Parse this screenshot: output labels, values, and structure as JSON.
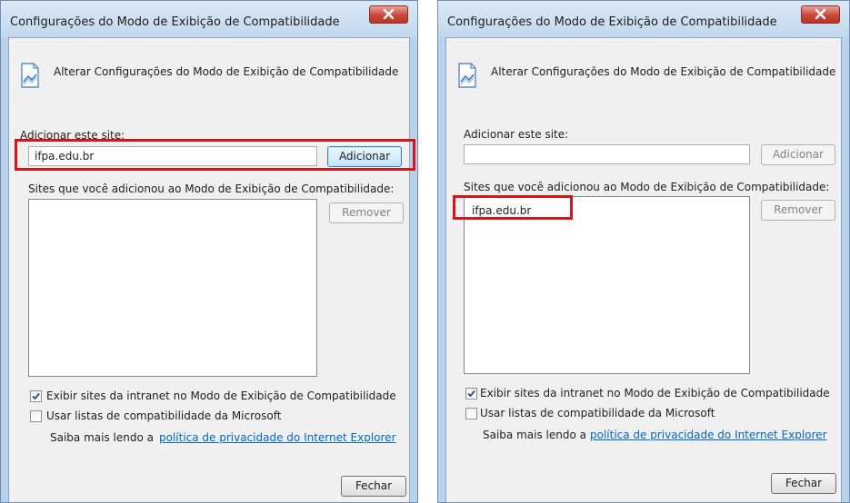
{
  "left": {
    "title": "Configurações do Modo de Exibição de Compatibilidade",
    "header": "Alterar Configurações do Modo de Exibição de Compatibilidade",
    "add_label": "Adicionar este site:",
    "add_input_value": "ifpa.edu.br",
    "add_button": "Adicionar",
    "list_label": "Sites que você adicionou ao Modo de Exibição de Compatibilidade:",
    "list_items": [],
    "remove_button": "Remover",
    "intranet_checkbox": "Exibir sites da intranet no Modo de Exibição de Compatibilidade",
    "intranet_checked": true,
    "ms_lists_checkbox": "Usar listas de compatibilidade da Microsoft",
    "ms_lists_checked": false,
    "privacy_prefix": "Saiba mais lendo a",
    "privacy_link": "política de privacidade do Internet Explorer",
    "close_button": "Fechar"
  },
  "right": {
    "title": "Configurações do Modo de Exibição de Compatibilidade",
    "header": "Alterar Configurações do Modo de Exibição de Compatibilidade",
    "add_label": "Adicionar este site:",
    "add_input_value": "",
    "add_button": "Adicionar",
    "list_label": "Sites que você adicionou ao Modo de Exibição de Compatibilidade:",
    "list_items": [
      "ifpa.edu.br"
    ],
    "remove_button": "Remover",
    "intranet_checkbox": "Exibir sites da intranet no Modo de Exibição de Compatibilidade",
    "intranet_checked": true,
    "ms_lists_checkbox": "Usar listas de compatibilidade da Microsoft",
    "ms_lists_checked": false,
    "privacy_prefix": "Saiba mais lendo a",
    "privacy_link": "política de privacidade do Internet Explorer",
    "close_button": "Fechar"
  },
  "icons": {
    "header": "compatibility-view-icon",
    "close": "close-icon",
    "check": "checkmark-icon"
  },
  "colors": {
    "highlight": "#d9131b",
    "link": "#0066cc",
    "close_button": "#c9473a",
    "frame": "#b9d1ea"
  }
}
